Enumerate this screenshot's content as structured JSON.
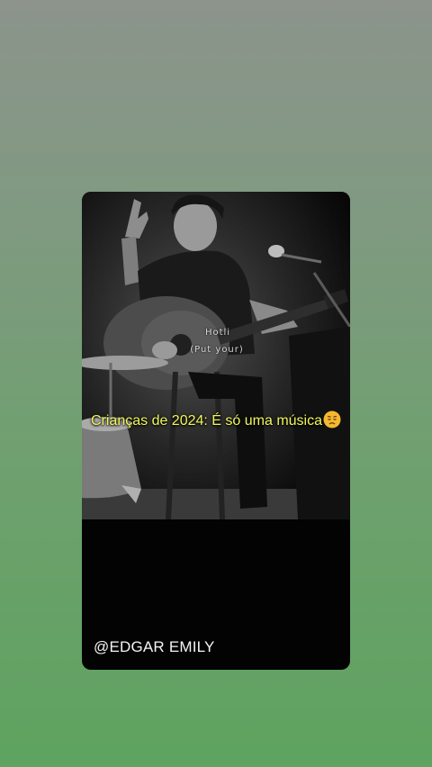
{
  "video": {
    "lyric_line_1": "Hotli",
    "lyric_line_2": "(Put your)"
  },
  "overlay": {
    "caption": "Crianças de 2024: É só uma música",
    "caption_emoji": "worried-face-emoji",
    "caption_color": "#f2f75a"
  },
  "footer": {
    "username": "@EDGAR EMILY"
  },
  "colors": {
    "card_background": "#030303",
    "page_gradient_top": "#8c948c",
    "page_gradient_bottom": "#5ea35f"
  }
}
